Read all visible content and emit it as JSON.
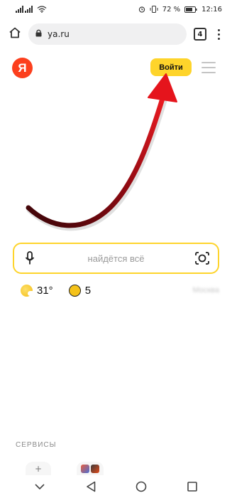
{
  "status_bar": {
    "battery_percent": "72 %",
    "time": "12:16"
  },
  "browser": {
    "url": "ya.ru",
    "tab_count": "4"
  },
  "header": {
    "logo_letter": "Я",
    "login_label": "Войти"
  },
  "search": {
    "placeholder": "найдётся всё"
  },
  "informers": {
    "temperature": "31°",
    "traffic_score": "5",
    "blurred_text": "Москва"
  },
  "services": {
    "title": "СЕРВИСЫ",
    "add_glyph": "+"
  },
  "colors": {
    "accent_yellow": "#fed42b",
    "logo_red": "#fc3f1d",
    "arrow_red": "#d3131a"
  },
  "icons": {
    "home": "home-icon",
    "lock": "lock-icon",
    "menu": "kebab-menu-icon",
    "mic": "microphone-icon",
    "camera": "camera-search-icon",
    "weather": "sun-cloud-icon",
    "traffic": "traffic-icon",
    "nav_hide": "chevron-down-icon",
    "nav_back": "back-triangle-icon",
    "nav_home": "home-circle-icon",
    "nav_recent": "recents-square-icon"
  }
}
